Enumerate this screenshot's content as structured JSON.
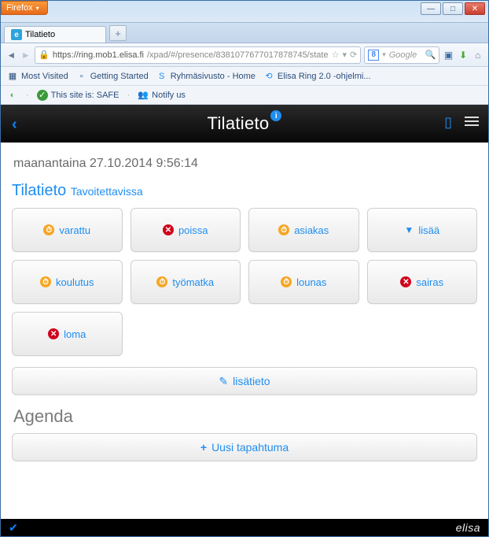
{
  "browser": {
    "name": "Firefox",
    "tab_title": "Tilatieto",
    "url_host": "https://ring.mob1.elisa.fi",
    "url_path": "/xpad/#/presence/8381077677017878745/state",
    "search_placeholder": "Google",
    "bookmarks1": {
      "most_visited": "Most Visited",
      "getting_started": "Getting Started",
      "ryhma": "Ryhmäsivusto - Home",
      "ring": "Elisa Ring 2.0 -ohjelmi..."
    },
    "bookmarks2": {
      "safe": "This site is: SAFE",
      "notify": "Notify us"
    },
    "window_buttons": {
      "min": "—",
      "max": "□",
      "close": "✕"
    }
  },
  "app": {
    "title": "Tilatieto",
    "timestamp": "maanantaina 27.10.2014 9:56:14",
    "section": "Tilatieto",
    "section_sub": "Tavoitettavissa",
    "tiles": [
      {
        "label": "varattu",
        "icon": "clock",
        "color": "orange"
      },
      {
        "label": "poissa",
        "icon": "x",
        "color": "red"
      },
      {
        "label": "asiakas",
        "icon": "clock",
        "color": "orange"
      },
      {
        "label": "lisää",
        "icon": "chev",
        "color": "blue"
      },
      {
        "label": "koulutus",
        "icon": "clock",
        "color": "orange"
      },
      {
        "label": "työmatka",
        "icon": "clock",
        "color": "orange"
      },
      {
        "label": "lounas",
        "icon": "clock",
        "color": "orange"
      },
      {
        "label": "sairas",
        "icon": "x",
        "color": "red"
      },
      {
        "label": "loma",
        "icon": "x",
        "color": "red"
      }
    ],
    "more_info": "lisätieto",
    "agenda_title": "Agenda",
    "new_event": "Uusi tapahtuma",
    "brand": "elisa"
  }
}
